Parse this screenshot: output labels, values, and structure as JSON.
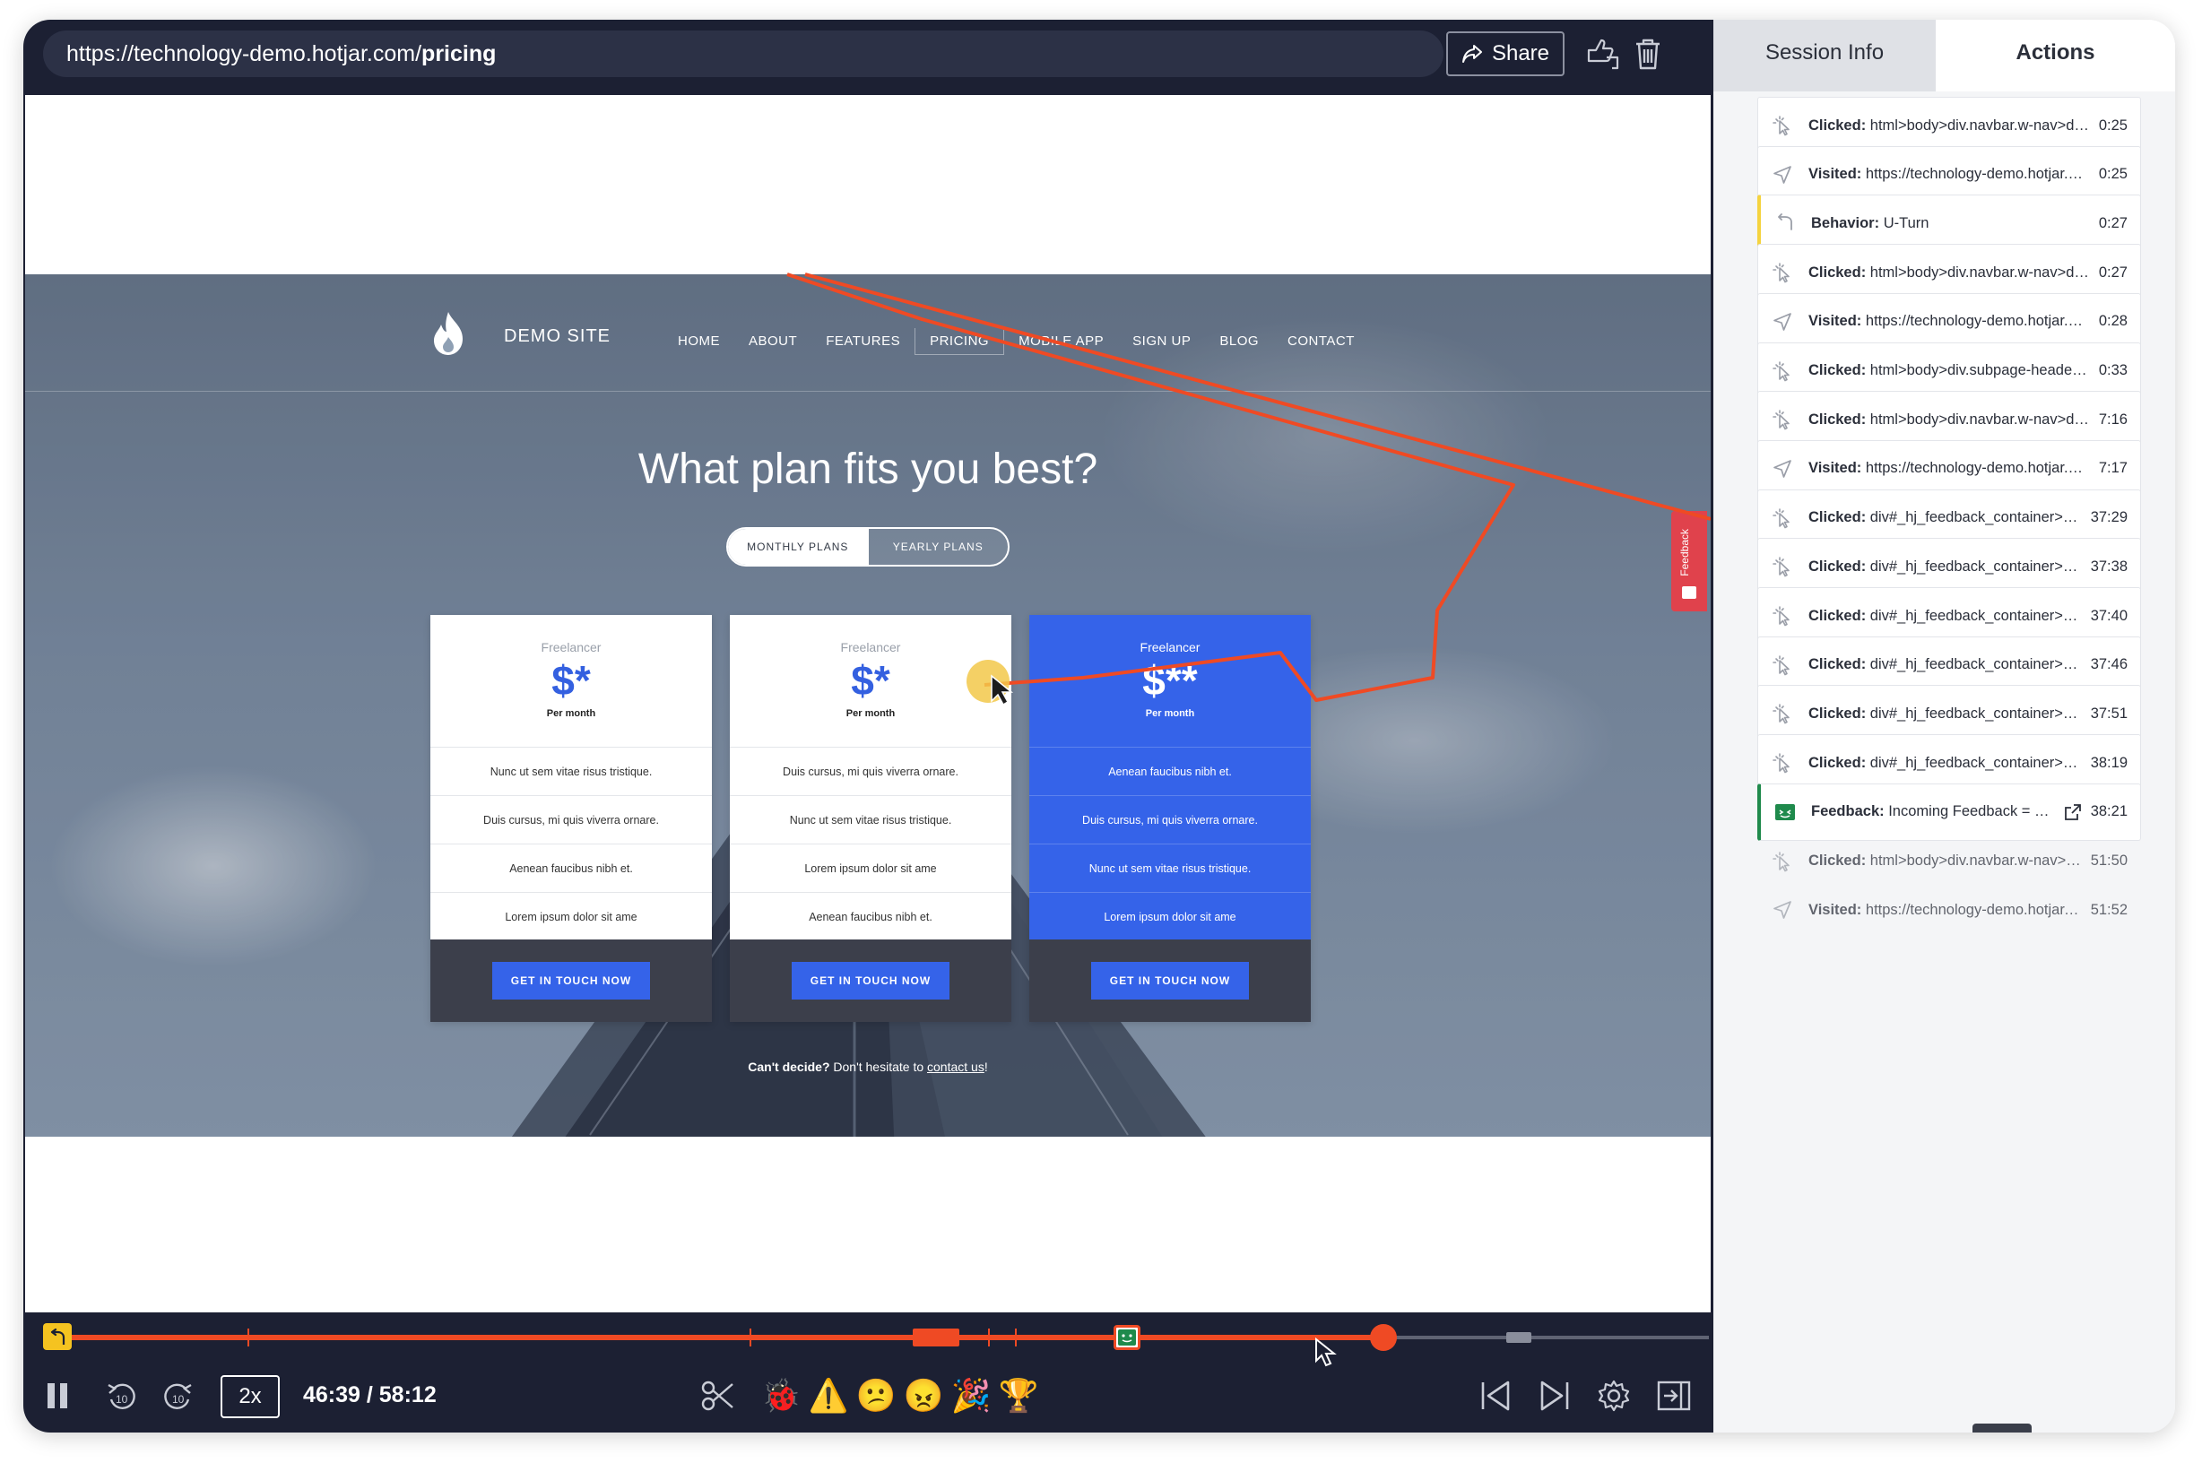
{
  "player": {
    "url_base": "https://technology-demo.hotjar.com/",
    "url_path": "pricing",
    "share_label": "Share"
  },
  "site": {
    "logo_text": "DEMO SITE",
    "nav": [
      "HOME",
      "ABOUT",
      "FEATURES",
      "PRICING",
      "MOBILE APP",
      "SIGN UP",
      "BLOG",
      "CONTACT"
    ],
    "active_nav": "PRICING",
    "headline": "What plan fits you best?",
    "toggle": {
      "monthly": "MONTHLY PLANS",
      "yearly": "YEARLY PLANS",
      "selected": "MONTHLY PLANS"
    },
    "plans": [
      {
        "tier": "Freelancer",
        "price": "$*",
        "per": "Per month",
        "featured": false,
        "features": [
          "Nunc ut sem vitae risus tristique.",
          "Duis cursus, mi quis viverra ornare.",
          "Aenean faucibus nibh et.",
          "Lorem ipsum dolor sit ame"
        ],
        "cta": "GET IN TOUCH NOW"
      },
      {
        "tier": "Freelancer",
        "price": "$*",
        "per": "Per month",
        "featured": false,
        "features": [
          "Duis cursus, mi quis viverra ornare.",
          "Nunc ut sem vitae risus tristique.",
          "Lorem ipsum dolor sit ame",
          "Aenean faucibus nibh et."
        ],
        "cta": "GET IN TOUCH NOW"
      },
      {
        "tier": "Freelancer",
        "price": "$**",
        "per": "Per month",
        "featured": true,
        "features": [
          "Aenean faucibus nibh et.",
          "Duis cursus, mi quis viverra ornare.",
          "Nunc ut sem vitae risus tristique.",
          "Lorem ipsum dolor sit ame"
        ],
        "cta": "GET IN TOUCH NOW"
      }
    ],
    "cant_decide_bold": "Can't decide?",
    "cant_decide_text": " Don't hesitate to ",
    "contact_link": "contact us",
    "cant_decide_end": "!",
    "feedback_tab": "Feedback"
  },
  "controls": {
    "speed": "2x",
    "time_current": "46:39",
    "time_total": "58:12",
    "time_readout": "46:39 / 58:12",
    "progress_fraction": 0.8015,
    "reaction_emojis": [
      "bug-icon",
      "warning-icon",
      "confused-face-icon",
      "angry-face-icon",
      "party-popper-icon",
      "trophy-icon"
    ]
  },
  "panel": {
    "tabs": {
      "session_info": "Session Info",
      "actions": "Actions",
      "selected": "Actions"
    },
    "actions": [
      {
        "type": "click",
        "label": "Clicked:",
        "detail": "html>body>div.navbar.w-nav>div...",
        "time": "0:25"
      },
      {
        "type": "visit",
        "label": "Visited:",
        "detail": "https://technology-demo.hotjar.co...",
        "time": "0:25"
      },
      {
        "type": "behavior",
        "label": "Behavior:",
        "detail": "U-Turn",
        "time": "0:27"
      },
      {
        "type": "click",
        "label": "Clicked:",
        "detail": "html>body>div.navbar.w-nav>div...",
        "time": "0:27"
      },
      {
        "type": "visit",
        "label": "Visited:",
        "detail": "https://technology-demo.hotjar.co...",
        "time": "0:28"
      },
      {
        "type": "click",
        "label": "Clicked:",
        "detail": "html>body>div.subpage-header.s...",
        "time": "0:33"
      },
      {
        "type": "click",
        "label": "Clicked:",
        "detail": "html>body>div.navbar.w-nav>div...",
        "time": "7:16"
      },
      {
        "type": "visit",
        "label": "Visited:",
        "detail": "https://technology-demo.hotjar.co...",
        "time": "7:17"
      },
      {
        "type": "click",
        "label": "Clicked:",
        "detail": "div#_hj_feedback_container>div...",
        "time": "37:29"
      },
      {
        "type": "click",
        "label": "Clicked:",
        "detail": "div#_hj_feedback_container>div...",
        "time": "37:38"
      },
      {
        "type": "click",
        "label": "Clicked:",
        "detail": "div#_hj_feedback_container>div...",
        "time": "37:40"
      },
      {
        "type": "click",
        "label": "Clicked:",
        "detail": "div#_hj_feedback_container>div...",
        "time": "37:46"
      },
      {
        "type": "click",
        "label": "Clicked:",
        "detail": "div#_hj_feedback_container>div...",
        "time": "37:51"
      },
      {
        "type": "click",
        "label": "Clicked:",
        "detail": "div#_hj_feedback_container>div...",
        "time": "38:19"
      },
      {
        "type": "feedback",
        "label": "Feedback:",
        "detail": "Incoming Feedback = Love",
        "time": "38:21"
      },
      {
        "type": "click",
        "label": "Clicked:",
        "detail": "html>body>div.navbar.w-nav>div...",
        "time": "51:50",
        "faded": true
      },
      {
        "type": "visit",
        "label": "Visited:",
        "detail": "https://technology-demo.hotjar.c...",
        "time": "51:52",
        "faded": true
      }
    ]
  },
  "colors": {
    "accent_orange": "#ef4a24",
    "pricing_blue": "#3563e9",
    "player_bg": "#1c2033",
    "behavior_yellow": "#f5d33f",
    "feedback_green": "#1f8a4c"
  }
}
